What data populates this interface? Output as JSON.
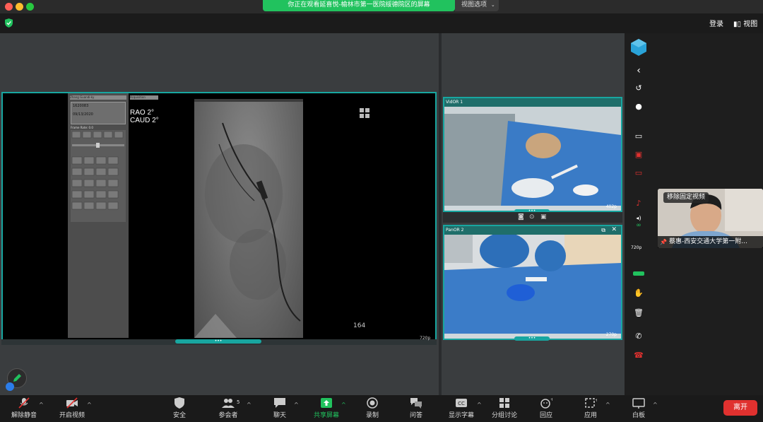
{
  "banner": {
    "text": "你正在观看延喜悦-榆林市第一医院绥德院区的屏幕",
    "view_options": "视图选项"
  },
  "topbar": {
    "login": "登录",
    "view": "视图"
  },
  "viewer": {
    "patient_name": "Zhang Guandi-ky",
    "id_line1": "1620083",
    "id_line2": "09/13/2020",
    "acquisition": "Acquisition",
    "frame_rate": "Frame Rate: 0.0",
    "angle_line1": "RAO      2°",
    "angle_line2": "CAUD    2°",
    "frame_number": "164",
    "resolution": "720p"
  },
  "videos": [
    {
      "label": "VidOR 1",
      "resolution": "402p"
    },
    {
      "label": "PanOR 2",
      "resolution": "270p"
    }
  ],
  "side_toolbar": {
    "res": "720p"
  },
  "participant": {
    "unpin": "移除固定视频",
    "name": "蔡惠-西安交通大学第一附..."
  },
  "toolbar": {
    "unmute": "解除静音",
    "start_video": "开启视频",
    "security": "安全",
    "participants": "参会者",
    "participants_count": "5",
    "chat": "聊天",
    "share": "共享屏幕",
    "record": "录制",
    "qa": "问答",
    "captions": "显示字幕",
    "breakout": "分组讨论",
    "reactions": "回应",
    "apps": "应用",
    "whiteboard": "白板",
    "leave": "离开"
  },
  "colors": {
    "accent": "#18a6a0",
    "share_green": "#21c25e",
    "leave_red": "#e0312f"
  }
}
